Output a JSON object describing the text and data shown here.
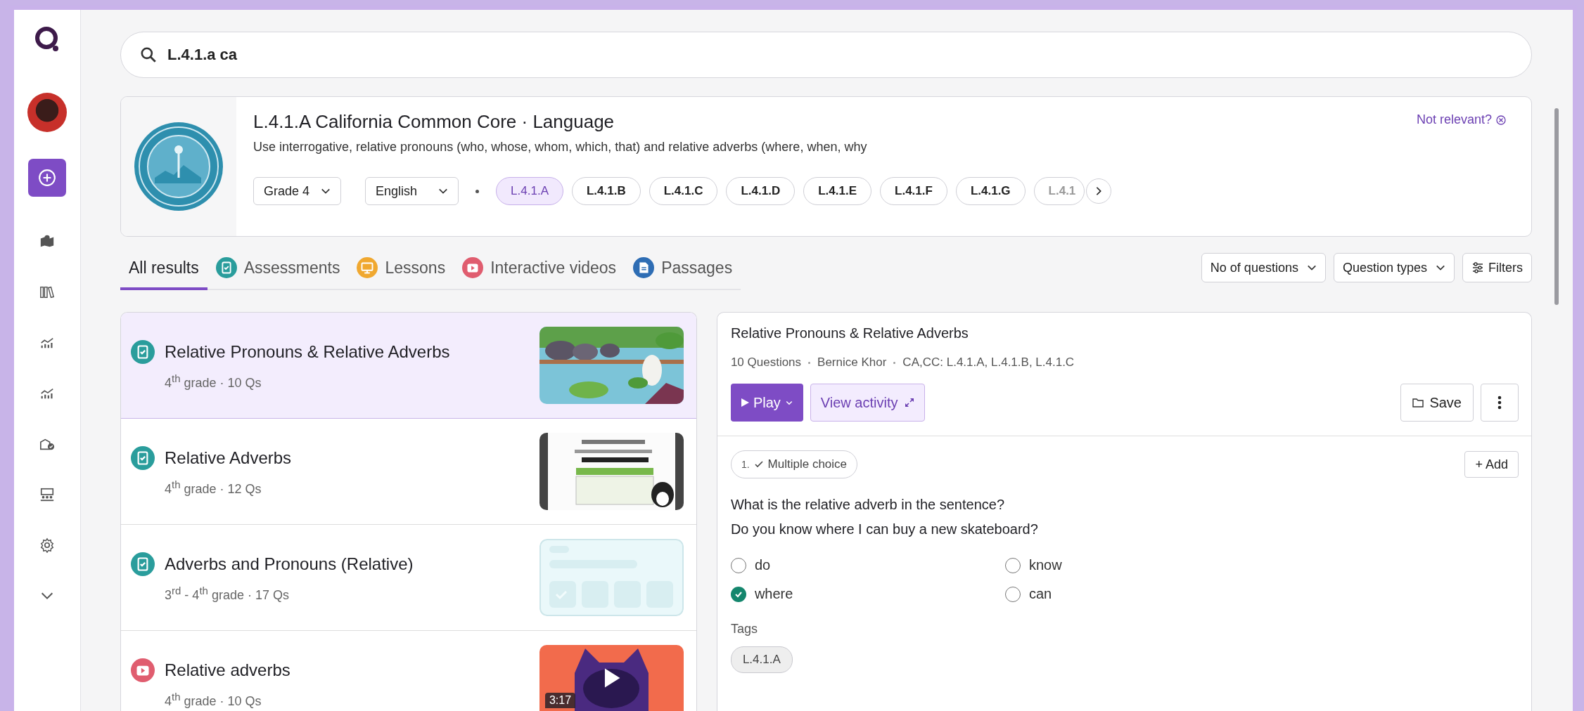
{
  "search": {
    "value": "L.4.1.a ca"
  },
  "standard": {
    "title": "L.4.1.A California Common Core · Language",
    "description": "Use interrogative, relative pronouns (who, whose, whom, which, that) and relative adverbs (where, when, why",
    "dismiss": "Not relevant?",
    "grade": "Grade 4",
    "language": "English",
    "codes": [
      {
        "label": "L.4.1.A",
        "selected": true
      },
      {
        "label": "L.4.1.B",
        "selected": false
      },
      {
        "label": "L.4.1.C",
        "selected": false
      },
      {
        "label": "L.4.1.D",
        "selected": false
      },
      {
        "label": "L.4.1.E",
        "selected": false
      },
      {
        "label": "L.4.1.F",
        "selected": false
      },
      {
        "label": "L.4.1.G",
        "selected": false
      },
      {
        "label": "L.4.1",
        "selected": false
      }
    ]
  },
  "tabs": [
    {
      "label": "All results",
      "kind": "all",
      "selected": true
    },
    {
      "label": "Assessments",
      "kind": "assessment",
      "selected": false
    },
    {
      "label": "Lessons",
      "kind": "lesson",
      "selected": false
    },
    {
      "label": "Interactive videos",
      "kind": "video",
      "selected": false
    },
    {
      "label": "Passages",
      "kind": "passage",
      "selected": false
    }
  ],
  "filters": [
    "No of questions",
    "Question types"
  ],
  "filters_button": "Filters",
  "results": [
    {
      "kind": "assessment",
      "title": "Relative Pronouns & Relative Adverbs",
      "meta": "4$^{th}$ grade · 10 Qs",
      "selected": true
    },
    {
      "kind": "assessment",
      "title": "Relative Adverbs",
      "meta": "4$^{th}$ grade · 12 Qs",
      "selected": false
    },
    {
      "kind": "assessment",
      "title": "Adverbs and Pronouns (Relative)",
      "meta": "3$^{rd}$ - 4$^{th}$ grade · 17 Qs",
      "selected": false
    },
    {
      "kind": "video",
      "title": "Relative adverbs",
      "meta": "4$^{th}$ grade · 10 Qs",
      "selected": false,
      "duration": "3:17"
    }
  ],
  "preview": {
    "title": "Relative Pronouns & Relative Adverbs",
    "meta": [
      "10 Questions",
      "Bernice Khor",
      "CA,CC: L.4.1.A, L.4.1.B, L.4.1.C"
    ],
    "play": "Play",
    "view": "View activity",
    "save": "Save",
    "question": {
      "number": "1.",
      "type": "Multiple choice",
      "add": "+ Add",
      "lines": [
        "What is the relative adverb in the sentence?",
        "Do you know where I can buy a new skateboard?"
      ],
      "options": [
        {
          "label": "do",
          "checked": false
        },
        {
          "label": "know",
          "checked": false
        },
        {
          "label": "where",
          "checked": true
        },
        {
          "label": "can",
          "checked": false
        }
      ]
    },
    "tags_label": "Tags",
    "tags": [
      "L.4.1.A"
    ]
  }
}
